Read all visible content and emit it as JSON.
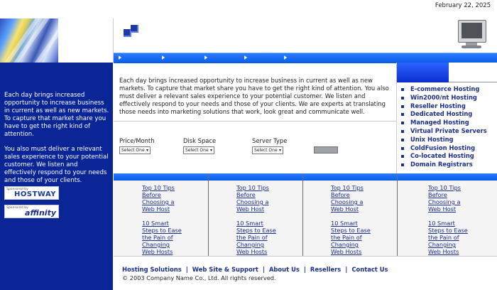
{
  "header": {
    "date": "February 22, 2025"
  },
  "nav": {
    "arrow_count": 5
  },
  "intro": {
    "text": "Each day brings increased opportunity to increase business in current as well as new markets. To capture that market share you have to get the right kind of attention. You also must deliver a relevant sales experience to your potential customer. We listen and effectively respond to your needs and those of your clients. We are experts at translating those needs into marketing solutions that work, look great and communicate well."
  },
  "sidebar": {
    "paragraph1": "Each day brings increased opportunity to increase business in current as well as new markets. To capture that market share you have to get the right kind of attention.",
    "paragraph2": "You also must deliver a relevant sales experience to your potential customer. We listen and effectively respond to your needs and those of your clients.",
    "sponsors": [
      {
        "tag": "Sponsored by",
        "brand": "HOSTWAY",
        "color": "#1a3a9c"
      },
      {
        "tag": "Sponsored by",
        "brand": "affinity",
        "color": "#1a2e8c"
      }
    ]
  },
  "filters": {
    "price_label": "Price/Month",
    "disk_label": "Disk Space",
    "server_label": "Server Type",
    "select_value": "Select One"
  },
  "hosting_links": [
    "E-commerce Hosting",
    "Win2000/nt Hosting",
    "Reseller Hosting",
    "Dedicated Hosting",
    "Managed Hosting",
    "Virtual Private Servers",
    "Unix Hosting",
    "ColdFusion Hosting",
    "Co-located Hosting",
    "Domain Registrars"
  ],
  "tips": {
    "link1": [
      "Top 10 Tips",
      "Before",
      "Choosing a",
      "Web Host"
    ],
    "link2": [
      "10 Smart",
      "Steps to Ease",
      "the Pain of",
      "Changing",
      "Web Hosts"
    ]
  },
  "footer": {
    "links": [
      "Hosting Solutions",
      "Web Site & Support",
      "About Us",
      "Resellers",
      "Contact Us"
    ],
    "copyright": "© 2003 Company Name Co., Ltd. All rights reserved."
  },
  "colors": {
    "primary_blue": "#0a2696",
    "nav_blue": "#0a5ce6",
    "link_blue": "#1a2e8c"
  }
}
